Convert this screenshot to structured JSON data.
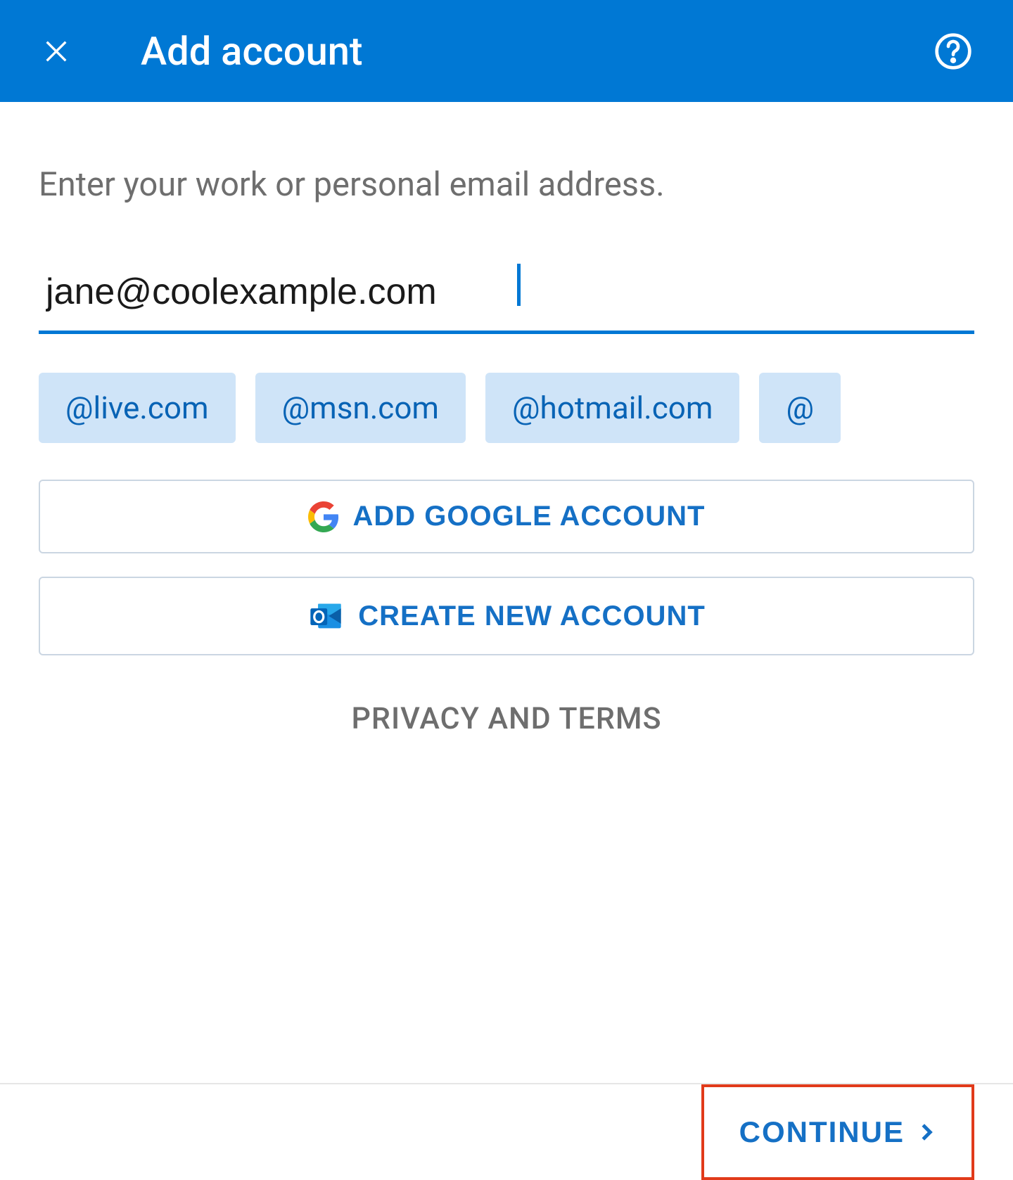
{
  "header": {
    "title": "Add account"
  },
  "content": {
    "instruction": "Enter your work or personal email address.",
    "email_value": "jane@coolexample.com",
    "suggestions": [
      "@live.com",
      "@msn.com",
      "@hotmail.com",
      "@"
    ],
    "google_button": "ADD GOOGLE ACCOUNT",
    "create_button": "CREATE NEW ACCOUNT",
    "privacy_link": "PRIVACY AND TERMS"
  },
  "footer": {
    "continue_button": "CONTINUE"
  }
}
